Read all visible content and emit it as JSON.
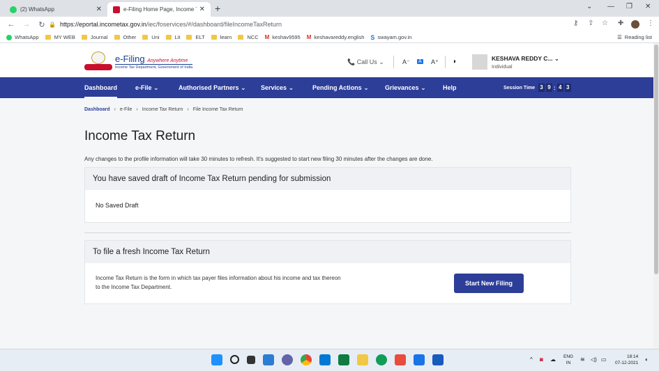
{
  "browser": {
    "tabs": [
      {
        "title": "(2) WhatsApp"
      },
      {
        "title": "e-Filing Home Page, Income Tax"
      }
    ],
    "url_domain": "https://eportal.incometax.gov.in",
    "url_path": "/iec/foservices/#/dashboard/fileIncomeTaxReturn",
    "bookmarks": [
      "WhatsApp",
      "MY WEB",
      "Journal",
      "Other",
      "Uni",
      "Lit",
      "ELT",
      "learn",
      "NCC",
      "keshav9595",
      "keshavareddy.english",
      "swayam.gov.in"
    ],
    "reading_list": "Reading list"
  },
  "header": {
    "logo_main": "e-Filing",
    "logo_tagline": "Anywhere Anytime",
    "logo_sub": "Income Tax Department, Government of India",
    "call_us": "Call Us",
    "font_small": "A⁻",
    "font_normal": "A",
    "font_large": "A⁺",
    "user_name": "KESHAVA REDDY C...",
    "user_type": "Individual"
  },
  "nav": {
    "items": [
      "Dashboard",
      "e-File",
      "Authorised Partners",
      "Services",
      "Pending Actions",
      "Grievances",
      "Help"
    ],
    "session_label": "Session Time",
    "session_digits": [
      "3",
      "9",
      "4",
      "3"
    ]
  },
  "breadcrumb": [
    "Dashboard",
    "e-File",
    "Income Tax Return",
    "File Income Tax Return"
  ],
  "main": {
    "title": "Income Tax Return",
    "note": "Any changes to the profile information will take 30 minutes to refresh. It's suggested to start new filing 30 minutes after the changes are done.",
    "draft_heading": "You have saved draft of Income Tax Return pending for submission",
    "draft_body": "No Saved Draft",
    "fresh_heading": "To file a fresh Income Tax Return",
    "fresh_body": "Income Tax Return is the form in which tax payer files information about his income and tax thereon to the Income Tax Department.",
    "start_button": "Start New Filing"
  },
  "taskbar": {
    "lang_1": "ENG",
    "lang_2": "IN",
    "time": "18:14",
    "date": "07-12-2021"
  },
  "colors": {
    "nav_bg": "#2c3e98",
    "brand_red": "#c8102e"
  }
}
